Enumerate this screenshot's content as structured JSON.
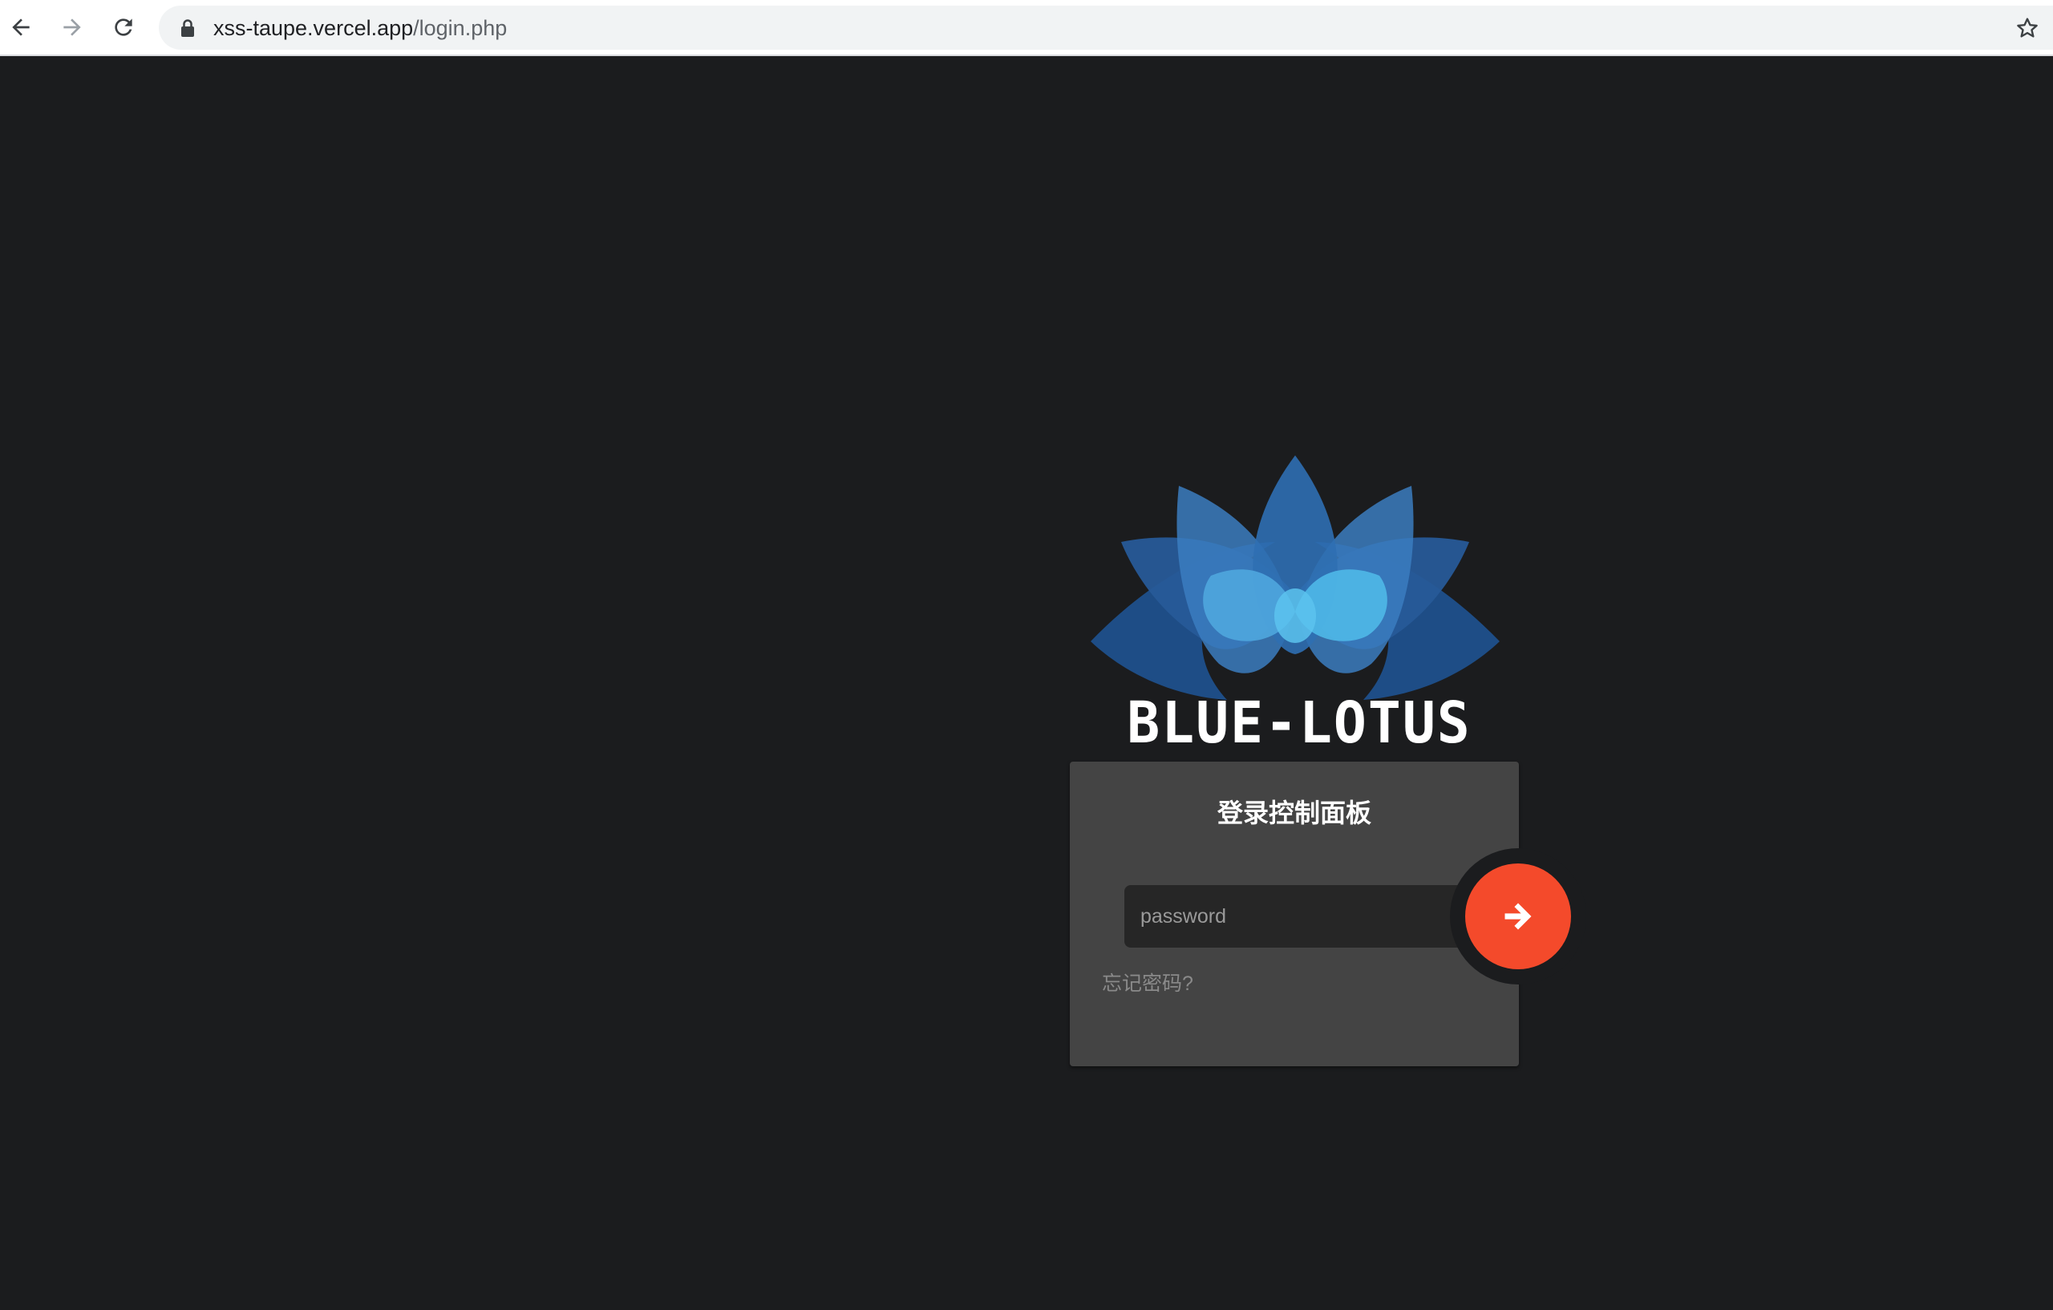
{
  "browser": {
    "url_host": "xss-taupe.vercel.app",
    "url_path": "/login.php"
  },
  "brand": {
    "name": "BLUE-LOTUS"
  },
  "login": {
    "title": "登录控制面板",
    "password_placeholder": "password",
    "forgot_label": "忘记密码?"
  },
  "icons": {
    "back": "arrow-left-icon",
    "forward": "arrow-right-icon",
    "reload": "reload-icon",
    "lock": "lock-icon",
    "bookmark": "star-icon",
    "submit": "arrow-right-icon",
    "logo": "lotus-icon"
  },
  "colors": {
    "page_background": "#1b1c1e",
    "card_background": "#444444",
    "input_background": "#262626",
    "accent": "#f44a2b",
    "lotus_dark": "#1e4d86",
    "lotus_light": "#4fb8e8"
  }
}
